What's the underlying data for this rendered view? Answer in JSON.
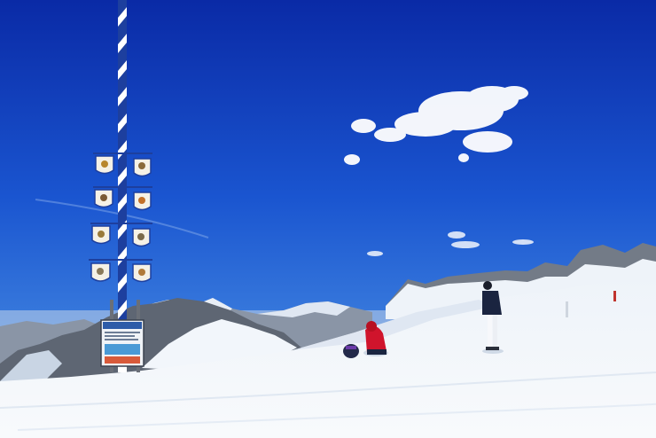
{
  "scene": {
    "colors": {
      "sky_top": "#0b2fb0",
      "sky_mid": "#1f5fd6",
      "sky_horizon": "#6fa6e8",
      "snow": "#f4f7fb",
      "snow_shadow": "#d8e2ef",
      "rock": "#6c7480",
      "pole_blue": "#1d3f9e",
      "pole_white": "#ffffff",
      "jacket_red": "#d0142c",
      "jacket_navy": "#1a2440"
    },
    "maypole": {
      "shields": [
        "crest",
        "figure",
        "figure",
        "figure",
        "figure",
        "figure",
        "figure",
        "figure"
      ]
    },
    "sign": {
      "description_icon": "trail-map-sign-icon"
    }
  }
}
